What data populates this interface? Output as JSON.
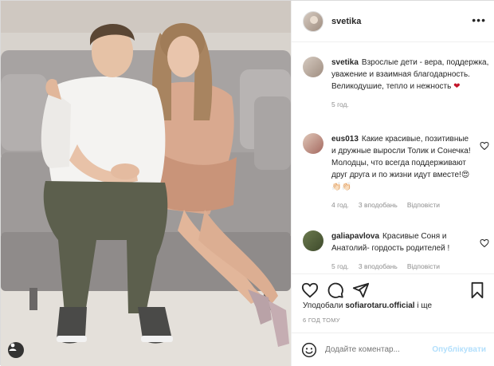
{
  "post": {
    "username": "svetika",
    "avatar_icon": "profile-avatar",
    "more_icon": "more-dots-icon"
  },
  "caption": {
    "user": "svetika",
    "text": "Взрослые дети - вера, поддержка, уважение и взаимная благодарность. Великодушие, тепло и нежность ❤",
    "age": "5 год."
  },
  "comments": [
    {
      "user": "eus013",
      "text": "Какие красивые, позитивные и дружные выросли Толик и Сонечка! Молодцы, что всегда поддерживают друг друга и по жизни идут вместе!😍👏🏻👏🏻",
      "age": "4 год.",
      "likes": "3 вподобань",
      "reply": "Відповісти"
    },
    {
      "user": "galiapavlova",
      "text": "Красивые Соня и Анатолий- гордость родителей !",
      "age": "5 год.",
      "likes": "3 вподобань",
      "reply": "Відповісти"
    }
  ],
  "actions": {
    "like_icon": "heart-icon",
    "comment_icon": "comment-icon",
    "share_icon": "share-icon",
    "save_icon": "bookmark-icon"
  },
  "likes": {
    "prefix": "Уподобали",
    "user": "sofiarotaru.official",
    "suffix": "і ще"
  },
  "timestamp": "6 ГОД ТОМУ",
  "add_comment": {
    "placeholder": "Додайте коментар...",
    "publish_label": "Опублікувати",
    "emoji_icon": "emoji-icon"
  },
  "colors": {
    "text": "#262626",
    "muted": "#8e8e8e",
    "publish_disabled": "#b2dffc",
    "heart_red": "#c4162a"
  }
}
